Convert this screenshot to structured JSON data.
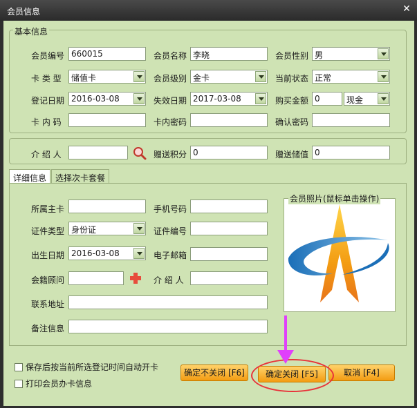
{
  "window": {
    "title": "会员信息",
    "close_glyph": "✕"
  },
  "basic": {
    "legend": "基本信息",
    "member_no_label": "会员编号",
    "member_no_value": "660015",
    "member_name_label": "会员名称",
    "member_name_value": "李晓",
    "gender_label": "会员性别",
    "gender_value": "男",
    "card_type_label": "卡 类 型",
    "card_type_value": "储值卡",
    "level_label": "会员级别",
    "level_value": "金卡",
    "status_label": "当前状态",
    "status_value": "正常",
    "reg_date_label": "登记日期",
    "reg_date_value": "2016-03-08",
    "expire_date_label": "失效日期",
    "expire_date_value": "2017-03-08",
    "purchase_label": "购买金额",
    "purchase_value": "0",
    "payment_value": "现金",
    "card_code_label": "卡 内 码",
    "card_pwd_label": "卡内密码",
    "confirm_pwd_label": "确认密码"
  },
  "referral": {
    "introducer_label": "介 绍 人",
    "bonus_points_label": "赠送积分",
    "bonus_points_value": "0",
    "bonus_stored_label": "赠送储值",
    "bonus_stored_value": "0"
  },
  "tabs": [
    {
      "label": "详细信息"
    },
    {
      "label": "选择次卡套餐"
    }
  ],
  "detail": {
    "main_card_label": "所属主卡",
    "phone_label": "手机号码",
    "id_type_label": "证件类型",
    "id_type_value": "身份证",
    "id_no_label": "证件编号",
    "birth_label": "出生日期",
    "birth_value": "2016-03-08",
    "email_label": "电子邮箱",
    "advisor_label": "会籍顾问",
    "introducer_label": "介 绍 人",
    "address_label": "联系地址",
    "remark_label": "备注信息",
    "photo_legend": "会员照片(鼠标单击操作)"
  },
  "footer": {
    "auto_open_label": "保存后按当前所选登记时间自动开卡",
    "print_label": "打印会员办卡信息",
    "confirm_keep_label": "确定不关闭 [F6]",
    "confirm_close_label": "确定关闭 [F5]",
    "cancel_label": "取消 [F4]"
  },
  "colors": {
    "panel": "#cfe3b4",
    "button": "#f39c12",
    "annotation": "#e8333a",
    "arrow": "#e040fb"
  }
}
